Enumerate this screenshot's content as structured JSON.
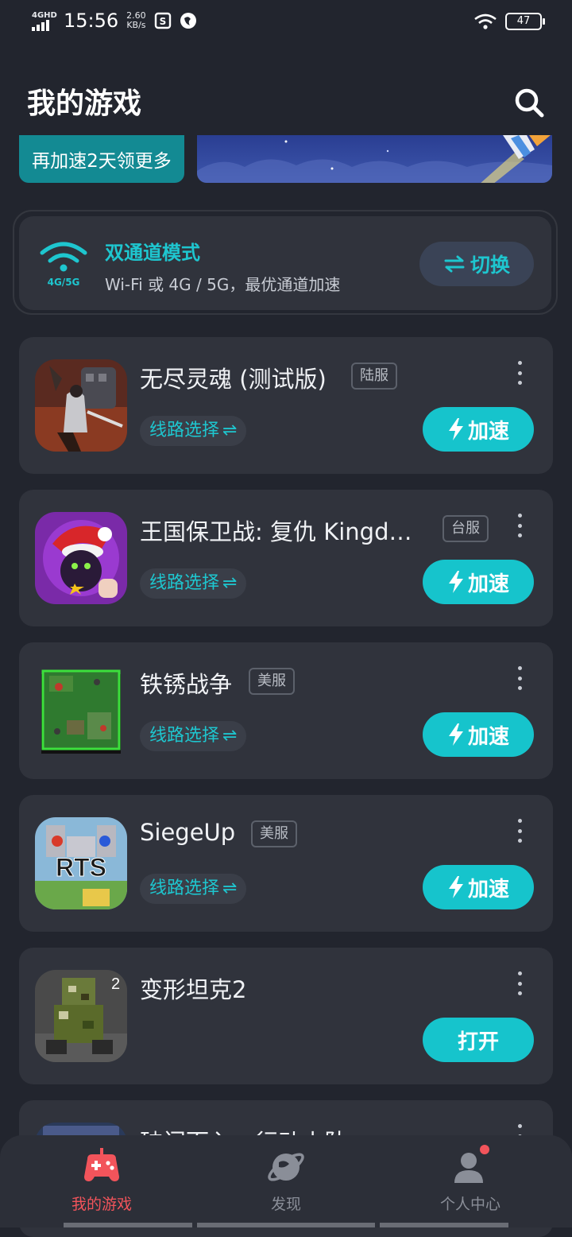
{
  "status_bar": {
    "network": "4GHD",
    "time": "15:56",
    "speed_value": "2.60",
    "speed_unit": "KB/s",
    "battery": "47"
  },
  "header": {
    "title": "我的游戏"
  },
  "promo": {
    "text": "再加速2天领更多"
  },
  "mode": {
    "network_label": "4G/5G",
    "title": "双通道模式",
    "description": "Wi-Fi 或 4G / 5G，最优通道加速",
    "switch_label": "切换"
  },
  "games": [
    {
      "name": "无尽灵魂 (测试版)",
      "region": "陆服",
      "route_label": "线路选择",
      "action": "加速"
    },
    {
      "name": "王国保卫战: 复仇 Kingd…",
      "region": "台服",
      "route_label": "线路选择",
      "action": "加速"
    },
    {
      "name": "铁锈战争",
      "region": "美服",
      "route_label": "线路选择",
      "action": "加速"
    },
    {
      "name": "SiegeUp",
      "region": "美服",
      "route_label": "线路选择",
      "action": "加速",
      "icon_text": "RTS"
    },
    {
      "name": "变形坦克2",
      "action": "打开"
    },
    {
      "name": "破门而入：行动小队"
    }
  ],
  "nav": [
    {
      "label": "我的游戏",
      "icon": "gamepad-icon",
      "active": true
    },
    {
      "label": "发现",
      "icon": "planet-icon"
    },
    {
      "label": "个人中心",
      "icon": "user-icon",
      "badge": true
    }
  ],
  "colors": {
    "accent": "#16c4cc",
    "active_tab": "#f2545b",
    "background": "#22252e",
    "card": "#30333c"
  }
}
